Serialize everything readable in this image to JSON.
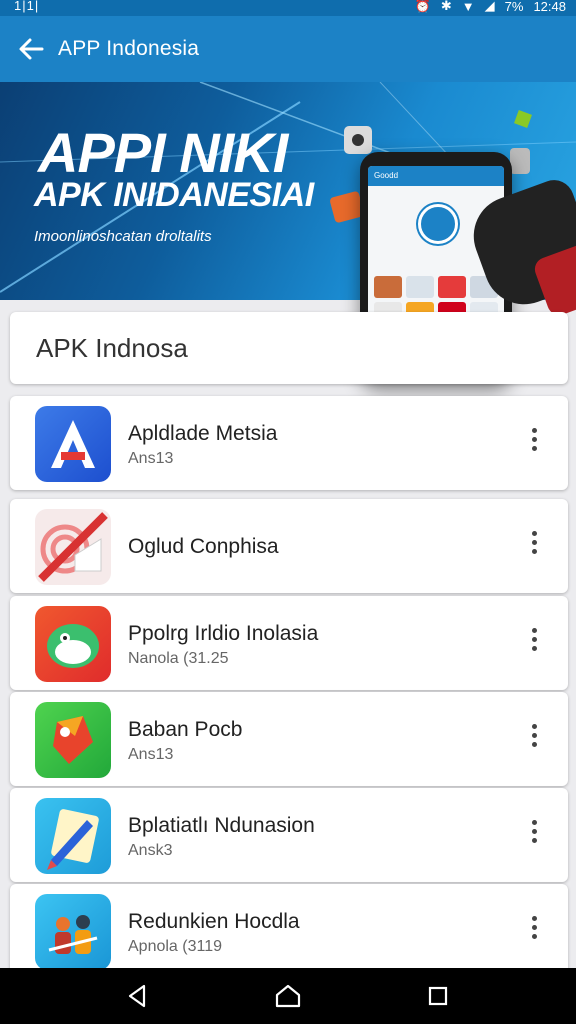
{
  "status": {
    "left": "1|1|",
    "time": "12:48",
    "battery": "7%"
  },
  "appbar": {
    "title": "APP Indonesia"
  },
  "banner": {
    "line1": "APPI NIKI",
    "line2": "APK INIDANESIAI",
    "tagline": "Imoonlinoshcatan droltalits",
    "phone_header": "Goodd"
  },
  "search": {
    "value": "APK Indnosa"
  },
  "apps": [
    {
      "name": "Apldlade Metsia",
      "sub": "Ans13"
    },
    {
      "name": "Oglud Conphisa",
      "sub": ""
    },
    {
      "name": "Ppolrg Irldio Inolasia",
      "sub": "Nanola (31.25"
    },
    {
      "name": "Baban Pocb",
      "sub": "Ans13"
    },
    {
      "name": "Bplatiatlı Ndunasion",
      "sub": "Ansk3"
    },
    {
      "name": "Redunkien Hocdla",
      "sub": "Apnola (3119"
    }
  ],
  "colors": {
    "appbar": "#1c82c6",
    "status": "#0f6dad",
    "background": "#ececef",
    "navbar": "#000000"
  }
}
